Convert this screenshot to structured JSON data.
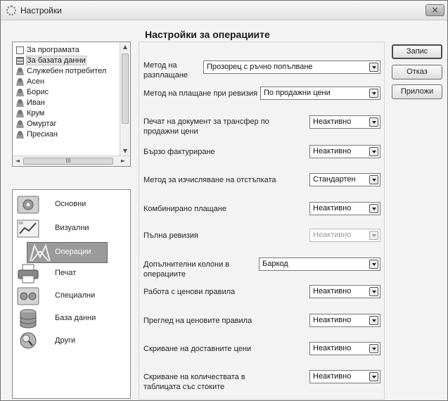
{
  "window": {
    "title": "Настройки",
    "close_label": "×"
  },
  "users": {
    "items": [
      {
        "label": "За програмата",
        "icon": "document-icon"
      },
      {
        "label": "За базата данни",
        "icon": "database-icon"
      },
      {
        "label": "Служебен потребител",
        "icon": "user-icon"
      },
      {
        "label": "Асен",
        "icon": "user-icon"
      },
      {
        "label": "Борис",
        "icon": "user-icon"
      },
      {
        "label": "Иван",
        "icon": "user-icon"
      },
      {
        "label": "Крум",
        "icon": "user-icon"
      },
      {
        "label": "Омуртаг",
        "icon": "user-icon"
      },
      {
        "label": "Пресиан",
        "icon": "user-icon"
      }
    ],
    "scroll_grip": "III"
  },
  "categories": [
    {
      "label": "Основни",
      "icon": "settings-general-icon"
    },
    {
      "label": "Визуални",
      "icon": "visual-icon"
    },
    {
      "label": "Операции",
      "icon": "operations-icon",
      "active": true
    },
    {
      "label": "Печат",
      "icon": "printer-icon"
    },
    {
      "label": "Специални",
      "icon": "special-icon"
    },
    {
      "label": "База данни",
      "icon": "database-icon"
    },
    {
      "label": "Други",
      "icon": "search-icon"
    }
  ],
  "panel": {
    "title": "Настройки за операциите",
    "rows": [
      {
        "label": "Метод на разплащане",
        "value": "Прозорец с ръчно попълване"
      },
      {
        "label": "Метод на плащане при ревизия",
        "value": "По продажни цени"
      },
      {
        "label": "Печат на документ за трансфер по продажни цени",
        "value": "Неактивно"
      },
      {
        "label": "Бързо фактуриране",
        "value": "Неактивно"
      },
      {
        "label": "Метод за изчисляване на отстъпката",
        "value": "Стандартен"
      },
      {
        "label": "Комбинирано плащане",
        "value": "Неактивно"
      },
      {
        "label": "Пълна ревизия",
        "value": "Неактивно",
        "disabled": true
      },
      {
        "label": "Допълнителни колони в операциите",
        "value": "Баркод"
      },
      {
        "label": "Работа с ценови правила",
        "value": "Неактивно"
      },
      {
        "label": "Преглед на ценовите правила",
        "value": "Неактивно"
      },
      {
        "label": "Скриване на доставните цени",
        "value": "Неактивно"
      },
      {
        "label": "Скриване на количествата в таблицата със стоките",
        "value": "Неактивно"
      }
    ]
  },
  "buttons": {
    "save": "Запис",
    "cancel": "Отказ",
    "apply": "Приложи"
  }
}
